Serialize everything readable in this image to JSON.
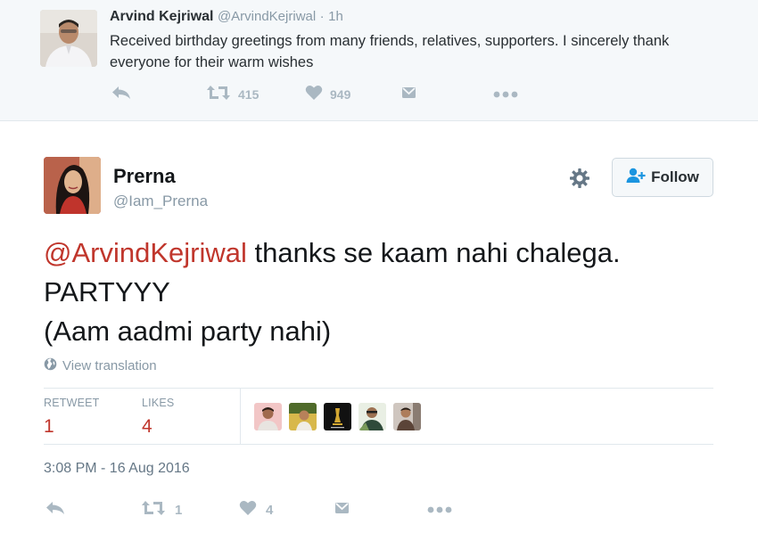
{
  "parent": {
    "name": "Arvind Kejriwal",
    "handle": "@ArvindKejriwal",
    "dot": "·",
    "time": "1h",
    "text": "Received birthday greetings from many friends, relatives, supporters. I sincerely thank everyone for their warm wishes",
    "retweets": "415",
    "likes": "949"
  },
  "tweet": {
    "name": "Prerna",
    "handle": "@Iam_Prerna",
    "mention": "@ArvindKejriwal",
    "line1_rest": " thanks se kaam nahi chalega.",
    "line2": "PARTYYY",
    "line3": "(Aam aadmi party nahi)",
    "follow_label": "Follow",
    "view_translation": "View translation",
    "retweet_label": "RETWEET",
    "retweet_count": "1",
    "likes_label": "LIKES",
    "likes_count": "4",
    "timestamp": "3:08 PM - 16 Aug 2016",
    "action_retweet_count": "1",
    "action_like_count": "4"
  },
  "icons": {
    "reply": "reply-icon",
    "retweet": "retweet-icon",
    "like": "heart-icon",
    "dm": "direct-message-icon",
    "more": "more-icon",
    "gear": "gear-icon",
    "follow": "add-user-icon",
    "globe": "globe-icon"
  },
  "colors": {
    "mention": "#c0362c",
    "count": "#c0362c",
    "muted": "#8899a6",
    "icon": "#aab8c2"
  }
}
